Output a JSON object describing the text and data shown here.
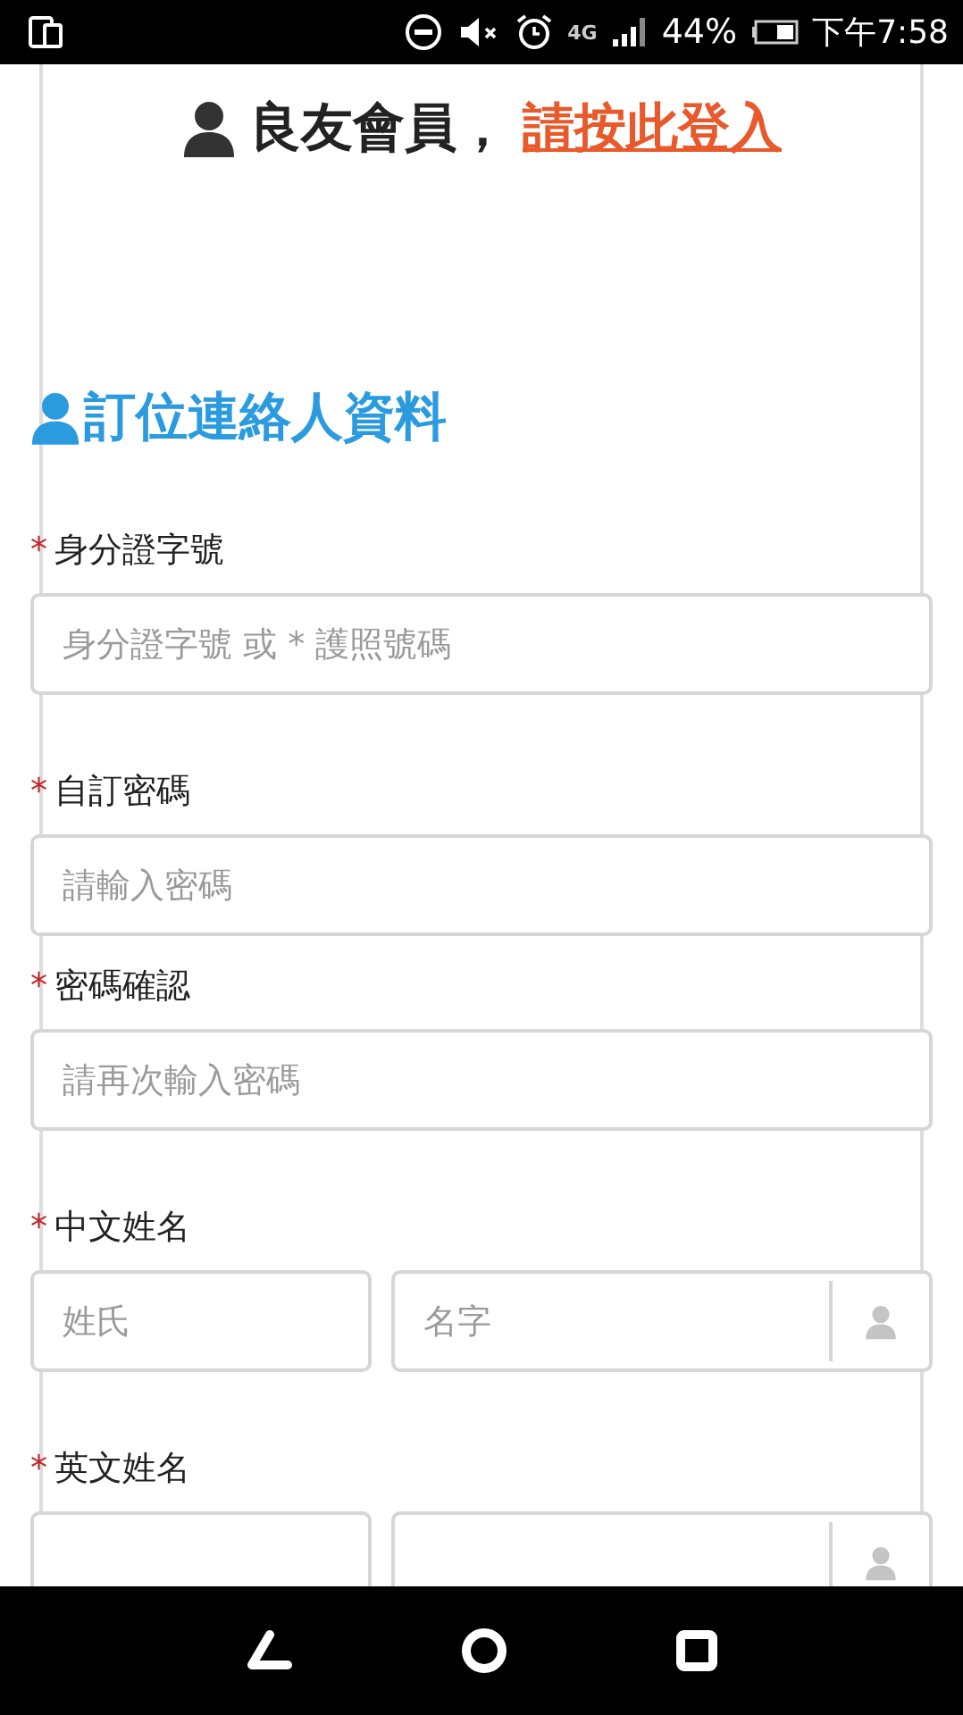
{
  "status_bar": {
    "network": "4G",
    "battery": "44%",
    "time": "下午7:58"
  },
  "member_banner": {
    "text": "良友會員，",
    "link": "請按此登入"
  },
  "section_title": "訂位連絡人資料",
  "groups": [
    {
      "fields": [
        {
          "kind": "single",
          "required_mark": "*",
          "label": "身分證字號",
          "placeholder": "身分證字號 或 * 護照號碼"
        }
      ]
    },
    {
      "fields": [
        {
          "kind": "single",
          "required_mark": "*",
          "label": "自訂密碼",
          "placeholder": "請輸入密碼"
        },
        {
          "kind": "single",
          "required_mark": "*",
          "label": "密碼確認",
          "placeholder": "請再次輸入密碼"
        }
      ]
    },
    {
      "fields": [
        {
          "kind": "name_pair",
          "required_mark": "*",
          "label": "中文姓名",
          "inputs": [
            {
              "placeholder": "姓氏",
              "addon": false
            },
            {
              "placeholder": "名字",
              "addon": true
            }
          ]
        }
      ]
    },
    {
      "fields": [
        {
          "kind": "name_pair",
          "required_mark": "*",
          "label": "英文姓名",
          "inputs": [
            {
              "addon": false
            },
            {
              "addon": true
            }
          ]
        }
      ]
    }
  ]
}
